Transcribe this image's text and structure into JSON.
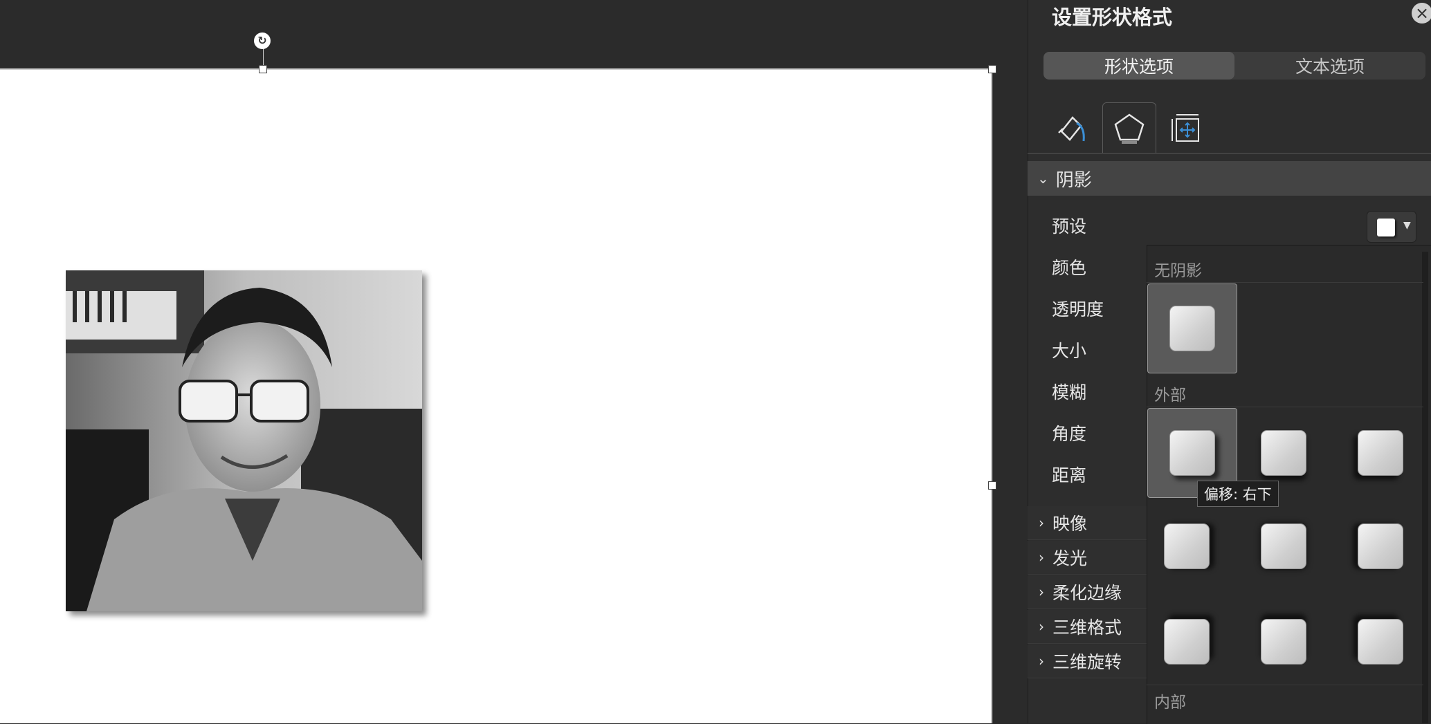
{
  "panel": {
    "title": "设置形状格式",
    "segments": [
      "形状选项",
      "文本选项"
    ],
    "active_segment": "形状选项",
    "tabs": [
      "fill-line-icon",
      "shape-effects-icon",
      "size-properties-icon"
    ],
    "active_tab": "shape-effects-icon",
    "section": "阴影",
    "props": [
      "预设",
      "颜色",
      "透明度",
      "大小",
      "模糊",
      "角度",
      "距离"
    ],
    "collapsed_sections": [
      "映像",
      "发光",
      "柔化边缘",
      "三维格式",
      "三维旋转"
    ]
  },
  "dropdown": {
    "no_shadow_label": "无阴影",
    "outer_label": "外部",
    "inner_label": "内部",
    "tooltip": "偏移: 右下"
  },
  "colors": {
    "panel_bg": "#2d2d2d",
    "accent_blue": "#3b8fd6"
  }
}
